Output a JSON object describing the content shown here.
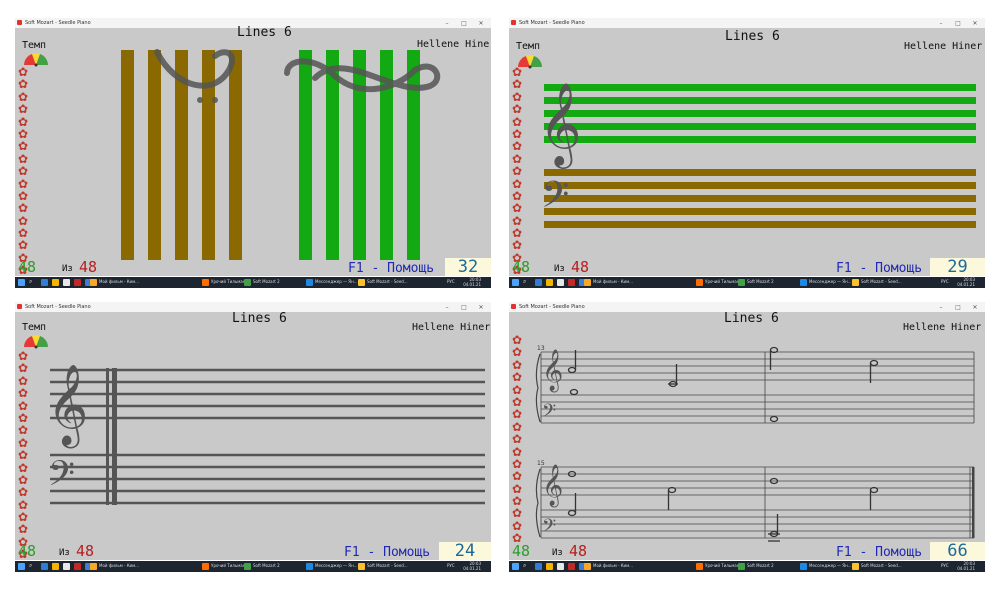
{
  "panels": [
    {
      "title": "Soft Mozart - Seedle Piano",
      "lesson": "Lines 6",
      "author": "Hellene Hiner",
      "tempo_label": "Темп",
      "done_count": "48",
      "of_label": "Из",
      "total_count": "48",
      "help": "F1 - Помощь",
      "score": "32"
    },
    {
      "title": "Soft Mozart - Seedle Piano",
      "lesson": "Lines 6",
      "author": "Hellene Hiner",
      "tempo_label": "Темп",
      "done_count": "48",
      "of_label": "Из",
      "total_count": "48",
      "help": "F1 - Помощь",
      "score": "29"
    },
    {
      "title": "Soft Mozart - Seedle Piano",
      "lesson": "Lines 6",
      "author": "Hellene Hiner",
      "tempo_label": "Темп",
      "done_count": "48",
      "of_label": "Из",
      "total_count": "48",
      "help": "F1 - Помощь",
      "score": "24"
    },
    {
      "title": "Soft Mozart - Seedle Piano",
      "lesson": "Lines 6",
      "author": "Hellene Hiner",
      "tempo_label": "",
      "done_count": "48",
      "of_label": "Из",
      "total_count": "48",
      "help": "F1 - Помощь",
      "score": "66",
      "measure_numbers": [
        "13",
        "15"
      ]
    }
  ],
  "taskbar": {
    "items": [
      "Мой фильм - Ким...",
      "Урочий Тильман",
      "Soft Mozart 2",
      "Soft Mozart - Seed...",
      "Мессенджер — Ян..."
    ],
    "lang": "РУС",
    "clock_time": "20:03",
    "clock_date": "04.01.21"
  },
  "colors": {
    "window_bg": "#c9c9c9",
    "bar_brown": "#8a6a00",
    "bar_green": "#13a913",
    "score_bg": "#fbf8dc",
    "help_blue": "#1f2ab0",
    "count_green": "#2a9d2a",
    "count_red": "#b81d1d"
  },
  "icons": [
    "app-icon",
    "minimize-icon",
    "maximize-icon",
    "close-icon",
    "tempo-gauge-icon",
    "flower-icon",
    "treble-clef-icon",
    "bass-clef-icon",
    "windows-start-icon",
    "search-icon"
  ]
}
